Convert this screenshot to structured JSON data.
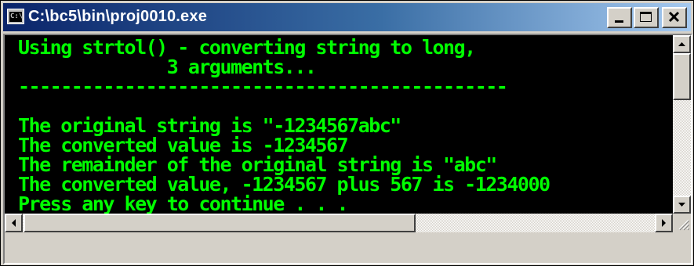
{
  "window": {
    "title": "C:\\bc5\\bin\\proj0010.exe",
    "icon": "console-window-icon",
    "buttons": {
      "minimize": "minimize-icon",
      "maximize": "maximize-icon",
      "close": "close-icon"
    }
  },
  "console": {
    "text_color": "#00ff00",
    "background": "#000000",
    "lines": [
      "Using strtol() - converting string to long,",
      "              3 arguments...",
      "----------------------------------------------",
      "",
      "The original string is \"-1234567abc\"",
      "The converted value is -1234567",
      "The remainder of the original string is \"abc\"",
      "The converted value, -1234567 plus 567 is -1234000",
      "Press any key to continue . . ."
    ]
  },
  "scrollbars": {
    "up": "scroll-up-arrow-icon",
    "down": "scroll-down-arrow-icon",
    "left": "scroll-left-arrow-icon",
    "right": "scroll-right-arrow-icon"
  }
}
